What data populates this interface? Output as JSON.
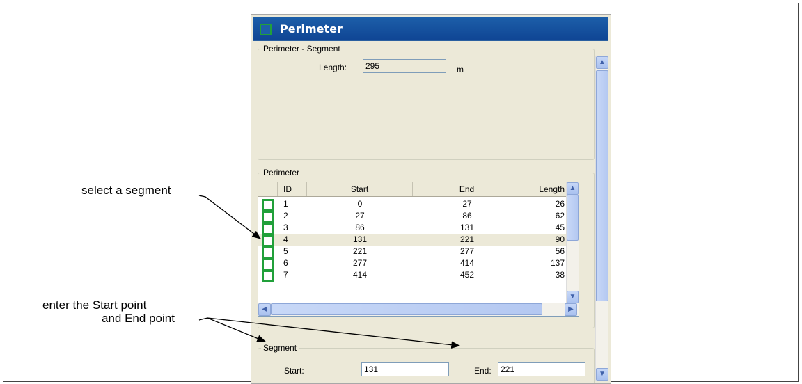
{
  "annotations": {
    "select_segment": "select a segment",
    "enter_points_line1": "enter the Start point",
    "enter_points_line2": "and End point"
  },
  "window": {
    "title": "Perimeter",
    "segment_group": {
      "legend": "Perimeter - Segment",
      "length_label": "Length:",
      "length_value": "295",
      "length_unit": "m"
    },
    "perimeter_group": {
      "legend": "Perimeter",
      "columns": [
        "ID",
        "Start",
        "End",
        "Length"
      ],
      "rows": [
        {
          "id": "1",
          "start": "0",
          "end": "27",
          "length": "26"
        },
        {
          "id": "2",
          "start": "27",
          "end": "86",
          "length": "62"
        },
        {
          "id": "3",
          "start": "86",
          "end": "131",
          "length": "45"
        },
        {
          "id": "4",
          "start": "131",
          "end": "221",
          "length": "90"
        },
        {
          "id": "5",
          "start": "221",
          "end": "277",
          "length": "56"
        },
        {
          "id": "6",
          "start": "277",
          "end": "414",
          "length": "137"
        },
        {
          "id": "7",
          "start": "414",
          "end": "452",
          "length": "38"
        }
      ],
      "selected_row_index": 3
    },
    "edit_group": {
      "legend": "Segment",
      "start_label": "Start:",
      "start_value": "131",
      "end_label": "End:",
      "end_value": "221"
    }
  },
  "colors": {
    "title_bar": "#1d5fa9",
    "checkbox_green": "#21a03a",
    "window_bg": "#ece9d8"
  }
}
